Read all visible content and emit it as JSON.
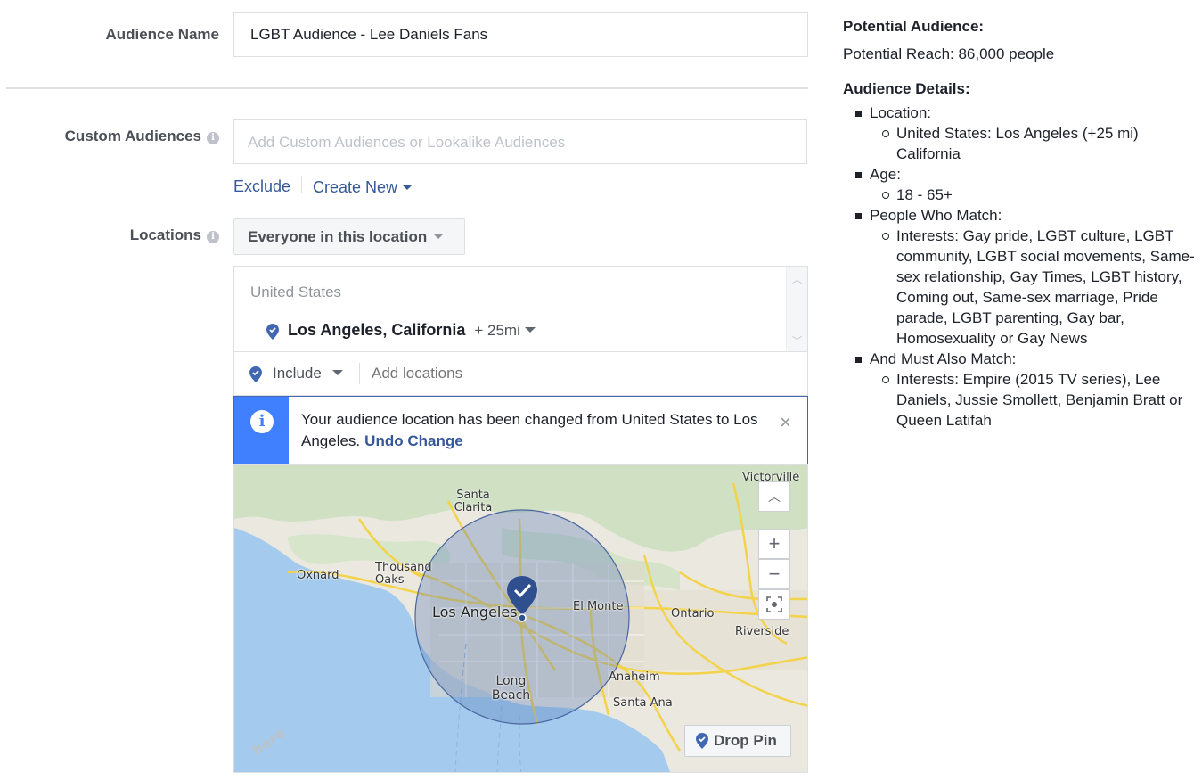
{
  "form": {
    "audience_name_label": "Audience Name",
    "audience_name_value": "LGBT Audience - Lee Daniels Fans",
    "custom_audiences_label": "Custom Audiences",
    "custom_audiences_placeholder": "Add Custom Audiences or Lookalike Audiences",
    "exclude_link": "Exclude",
    "create_new_link": "Create New",
    "locations_label": "Locations",
    "location_type_dropdown": "Everyone in this location",
    "selected_country": "United States",
    "selected_city": "Los Angeles, California",
    "radius": "+ 25mi",
    "include_label": "Include",
    "add_locations_placeholder": "Add locations",
    "info_icon": "i"
  },
  "notice": {
    "message": "Your audience location has been changed from United States to Los Angeles.",
    "undo_label": "Undo Change",
    "close_glyph": "×",
    "icon_glyph": "i",
    "accent_color": "#4080ff"
  },
  "map": {
    "labels": [
      "Santa Clarita",
      "Victorville",
      "Oxnard",
      "Thousand Oaks",
      "Los Angeles",
      "El Monte",
      "Ontario",
      "Riverside",
      "Long Beach",
      "Anaheim",
      "Santa Ana"
    ],
    "drop_pin_label": "Drop Pin",
    "watermark": "here",
    "zoom_in": "+",
    "zoom_out": "−",
    "collapse": "^"
  },
  "summary": {
    "potential_audience_heading": "Potential Audience:",
    "potential_reach": "Potential Reach: 86,000 people",
    "details_heading": "Audience Details:",
    "sections": [
      {
        "title": "Location:",
        "items": [
          "United States: Los Angeles (+25 mi) California"
        ]
      },
      {
        "title": "Age:",
        "items": [
          "18 - 65+"
        ]
      },
      {
        "title": "People Who Match:",
        "items": [
          "Interests: Gay pride, LGBT culture, LGBT community, LGBT social movements, Same-sex relationship, Gay Times, LGBT history, Coming out, Same-sex marriage, Pride parade, LGBT parenting, Gay bar, Homosexuality or Gay News"
        ]
      },
      {
        "title": "And Must Also Match:",
        "items": [
          "Interests: Empire (2015 TV series), Lee Daniels, Jussie Smollett, Benjamin Bratt or Queen Latifah"
        ]
      }
    ]
  }
}
